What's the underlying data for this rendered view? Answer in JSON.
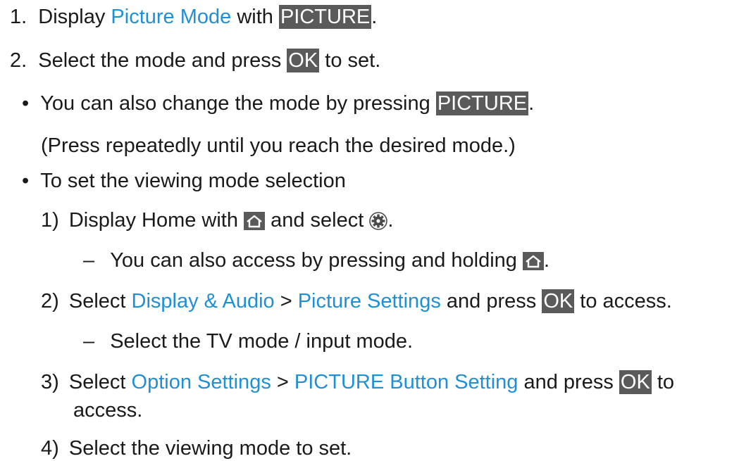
{
  "colors": {
    "text": "#1a1a1a",
    "link": "#1f8fd6",
    "key_background": "#5a5a5a",
    "key_text": "#ffffff"
  },
  "step1": {
    "number": "1.",
    "text_a": "Display ",
    "link": "Picture Mode",
    "text_b": " with ",
    "key": "PICTURE",
    "text_c": "."
  },
  "step2": {
    "number": "2.",
    "text_a": "Select the mode and press ",
    "key": "OK",
    "text_b": " to set."
  },
  "bullet1": {
    "marker": "•",
    "text_a": "You can also change the mode by pressing ",
    "key": "PICTURE",
    "text_b": ".",
    "note": "(Press repeatedly until you reach the desired mode.)"
  },
  "bullet2": {
    "marker": "•",
    "text": "To set the viewing mode selection"
  },
  "sub1": {
    "number": "1)",
    "text_a": "Display Home with ",
    "icon_home": "home-icon",
    "text_b": " and select ",
    "icon_settings": "settings-gear-icon",
    "text_c": ".",
    "dash_marker": "–",
    "dash_text_a": "You can also access by pressing and holding ",
    "dash_text_b": "."
  },
  "sub2": {
    "number": "2)",
    "text_a": "Select ",
    "link1": "Display & Audio",
    "text_b": " > ",
    "link2": "Picture Settings",
    "text_c": " and press ",
    "key": "OK",
    "text_d": " to access.",
    "dash_marker": "–",
    "dash_text": "Select the TV mode / input mode."
  },
  "sub3": {
    "number": "3)",
    "text_a": "Select ",
    "link1": "Option Settings",
    "text_b": " > ",
    "link2": "PICTURE Button Setting",
    "text_c": " and press ",
    "key": "OK",
    "text_d": " to",
    "text_e": "access."
  },
  "sub4": {
    "number": "4)",
    "text": "Select the viewing mode to set."
  }
}
